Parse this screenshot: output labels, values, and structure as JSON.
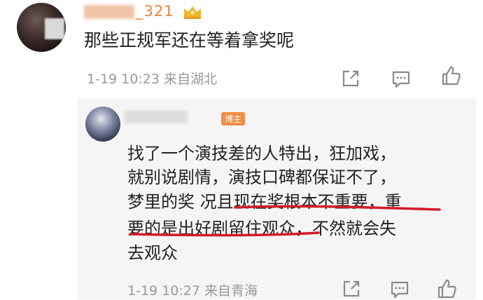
{
  "comment": {
    "username": "_321",
    "text": "那些正规军还在等着拿奖呢",
    "meta": "1-19 10:23 来自湖北"
  },
  "reply": {
    "username": "",
    "badge": "博主",
    "lines": [
      "找了一个演技差的人特出，狂加戏，",
      "就别说剧情，演技口碑都保证不了，",
      "梦里的奖 况且现在奖根本不重要，重",
      "要的是出好剧留住观众，不然就会失",
      "去观众"
    ],
    "meta": "1-19 10:27 来自青海"
  },
  "icons": [
    "share-icon",
    "comment-icon",
    "like-icon",
    "crown-icon"
  ],
  "colors": {
    "username": "#e8823a",
    "badge": "#f28d45",
    "underline": "#d11b2a"
  }
}
